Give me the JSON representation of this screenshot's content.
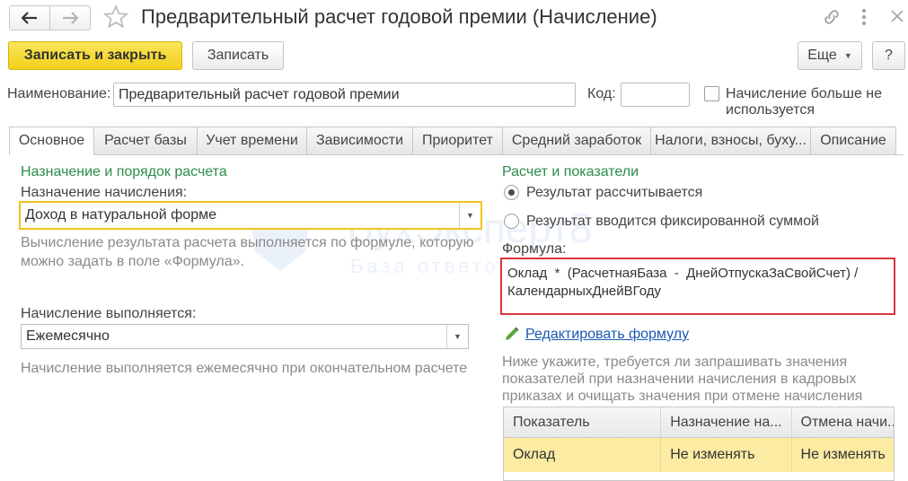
{
  "window": {
    "title": "Предварительный расчет годовой премии (Начисление)"
  },
  "toolbar": {
    "save_close": "Записать и закрыть",
    "save": "Записать",
    "more": "Еще",
    "help": "?"
  },
  "header": {
    "name_label": "Наименование:",
    "name_value": "Предварительный расчет годовой премии",
    "code_label": "Код:",
    "code_value": "",
    "unused_label_line1": "Начисление больше не",
    "unused_label_line2": "используется"
  },
  "tabs": [
    {
      "label": "Основное"
    },
    {
      "label": "Расчет базы"
    },
    {
      "label": "Учет времени"
    },
    {
      "label": "Зависимости"
    },
    {
      "label": "Приоритет"
    },
    {
      "label": "Средний заработок"
    },
    {
      "label": "Налоги, взносы, буху..."
    },
    {
      "label": "Описание"
    }
  ],
  "left": {
    "section_title": "Назначение и порядок расчета",
    "purpose_label": "Назначение начисления:",
    "purpose_value": "Доход в натуральной форме",
    "purpose_hint_line1": "Вычисление результата расчета выполняется по формуле, которую",
    "purpose_hint_line2": "можно задать в поле «Формула».",
    "period_label": "Начисление выполняется:",
    "period_value": "Ежемесячно",
    "period_hint": "Начисление выполняется ежемесячно при окончательном расчете"
  },
  "right": {
    "section_title": "Расчет и показатели",
    "radio_calculated": "Результат рассчитывается",
    "radio_fixed": "Результат вводится фиксированной суммой",
    "formula_label": "Формула:",
    "formula_line1": "Оклад  *  (РасчетнаяБаза  -  ДнейОтпускаЗаСвойСчет) /",
    "formula_line2": "КалендарныхДнейВГоду",
    "edit_formula_link": "Редактировать формулу",
    "indicators_hint_line1": "Ниже укажите, требуется ли запрашивать значения",
    "indicators_hint_line2": "показателей при назначении начисления в кадровых",
    "indicators_hint_line3": "приказах и очищать значения при отмене начисления"
  },
  "indicators_table": {
    "columns": [
      "Показатель",
      "Назначение на...",
      "Отмена начи..."
    ],
    "rows": [
      [
        "Оклад",
        "Не изменять",
        "Не изменять"
      ]
    ]
  },
  "watermark": {
    "line1": "БухЭксперт8",
    "line2": "База ответов"
  }
}
